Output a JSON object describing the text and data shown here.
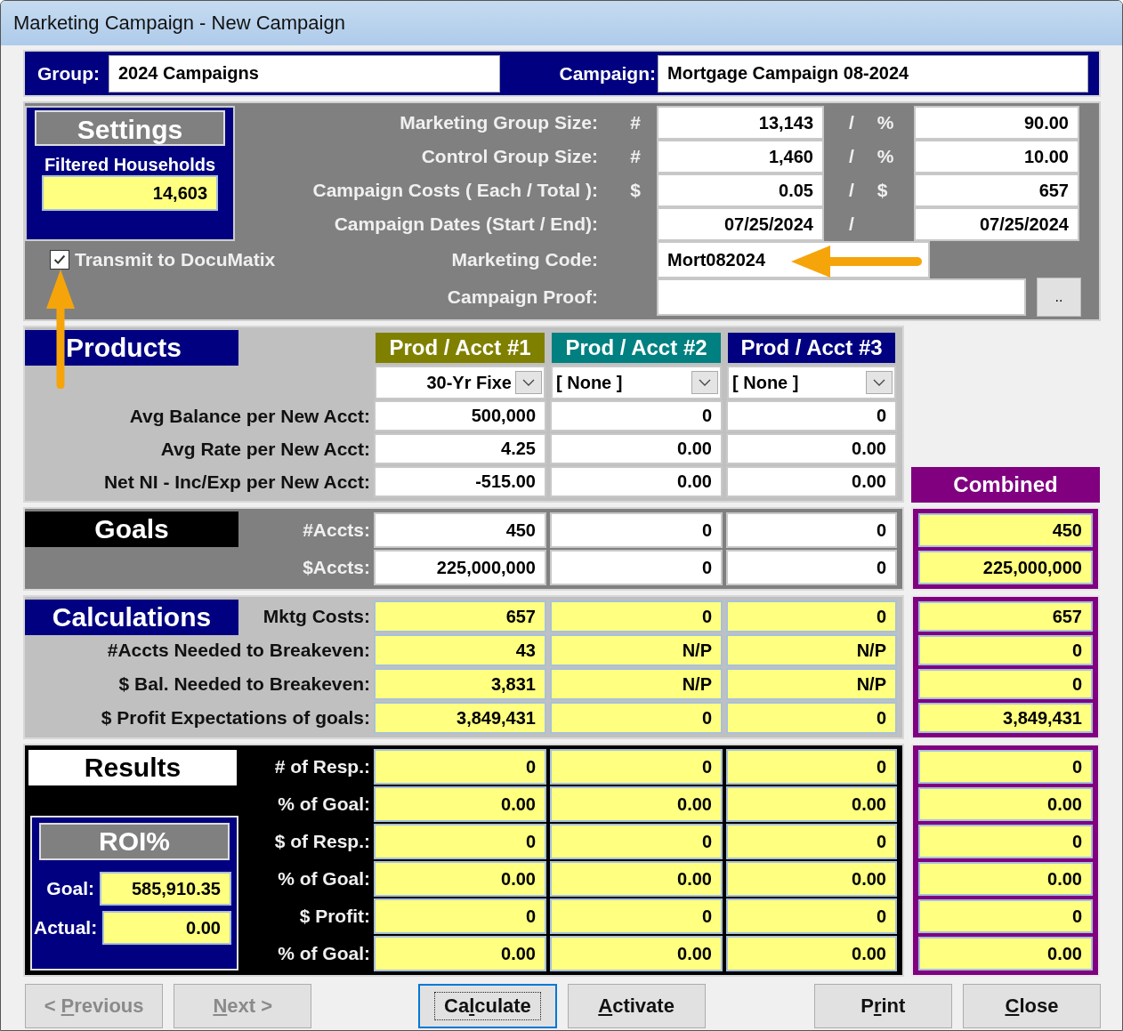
{
  "window": {
    "title": "Marketing Campaign - New Campaign"
  },
  "header": {
    "group_label": "Group:",
    "group": "2024 Campaigns",
    "campaign_label": "Campaign:",
    "campaign": "Mortgage Campaign 08-2024"
  },
  "settings": {
    "title": "Settings",
    "households_label": "Filtered Households",
    "households": "14,603",
    "transmit": {
      "label": "Transmit to DocuMatix",
      "checked": true
    },
    "rows": [
      {
        "label": "Marketing Group Size:",
        "symbol": "#",
        "value": "13,143",
        "separator": "/",
        "symbol_2": "%",
        "value_2": "90.00"
      },
      {
        "label": "Control Group Size:",
        "symbol": "#",
        "value": "1,460",
        "separator": "/",
        "symbol_2": "%",
        "value_2": "10.00"
      },
      {
        "label": "Campaign Costs ( Each / Total ):",
        "symbol": "$",
        "value": "0.05",
        "separator": "/",
        "symbol_2": "$",
        "value_2": "657"
      },
      {
        "label": "Campaign Dates  (Start / End):",
        "value": "07/25/2024",
        "separator": "/",
        "value_2": "07/25/2024"
      }
    ],
    "marketing_code": {
      "label": "Marketing Code:",
      "value": "Mort082024"
    },
    "proof": {
      "label": "Campaign Proof:",
      "button": ".."
    }
  },
  "products": {
    "title": "Products",
    "columns": [
      {
        "heading": "Prod / Acct #1",
        "color": "#808000",
        "selection": "30-Yr Fixe",
        "kind": "truncated"
      },
      {
        "heading": "Prod / Acct #2",
        "color": "#008080",
        "selection": "[ None ]",
        "kind": "plain"
      },
      {
        "heading": "Prod / Acct #3",
        "color": "#000080",
        "selection": "[ None ]",
        "kind": "plain"
      }
    ],
    "rows": [
      {
        "label": "Avg Balance per New Acct:",
        "values": [
          "500,000",
          "0",
          "0"
        ]
      },
      {
        "label": "Avg Rate per New Acct:",
        "values": [
          "4.25",
          "0.00",
          "0.00"
        ]
      },
      {
        "label": "Net NI - Inc/Exp per New Acct:",
        "values": [
          "-515.00",
          "0.00",
          "0.00"
        ]
      }
    ]
  },
  "combined": {
    "title": "Combined"
  },
  "goals": {
    "title": "Goals",
    "rows": [
      {
        "label": "#Accts:",
        "values": [
          "450",
          "0",
          "0"
        ],
        "combined": "450"
      },
      {
        "label": "$Accts:",
        "values": [
          "225,000,000",
          "0",
          "0"
        ],
        "combined": "225,000,000"
      }
    ]
  },
  "calculations": {
    "title": "Calculations",
    "rows": [
      {
        "label": "Mktg Costs:",
        "values": [
          "657",
          "0",
          "0"
        ],
        "combined": "657"
      },
      {
        "label": "#Accts Needed to Breakeven:",
        "values": [
          "43",
          "N/P",
          "N/P"
        ],
        "combined": "0"
      },
      {
        "label": "$ Bal. Needed to Breakeven:",
        "values": [
          "3,831",
          "N/P",
          "N/P"
        ],
        "combined": "0"
      },
      {
        "label": "$ Profit Expectations of goals:",
        "values": [
          "3,849,431",
          "0",
          "0"
        ],
        "combined": "3,849,431"
      }
    ]
  },
  "results": {
    "title": "Results",
    "rows": [
      {
        "label": "# of Resp.:",
        "values": [
          "0",
          "0",
          "0"
        ],
        "combined": "0"
      },
      {
        "label": "% of Goal:",
        "values": [
          "0.00",
          "0.00",
          "0.00"
        ],
        "combined": "0.00"
      },
      {
        "label": "$ of Resp.:",
        "values": [
          "0",
          "0",
          "0"
        ],
        "combined": "0"
      },
      {
        "label": "% of Goal:",
        "values": [
          "0.00",
          "0.00",
          "0.00"
        ],
        "combined": "0.00"
      },
      {
        "label": "$ Profit:",
        "values": [
          "0",
          "0",
          "0"
        ],
        "combined": "0"
      },
      {
        "label": "% of Goal:",
        "values": [
          "0.00",
          "0.00",
          "0.00"
        ],
        "combined": "0.00"
      }
    ],
    "roi": {
      "title": "ROI%",
      "goal_label": "Goal:",
      "goal": "585,910.35",
      "actual_label": "Actual:",
      "actual": "0.00"
    }
  },
  "buttons": [
    {
      "before": "< ",
      "key": "P",
      "after": "revious",
      "disabled": true,
      "focused": false
    },
    {
      "key": "N",
      "after": "ext >",
      "disabled": true,
      "focused": false
    },
    {
      "before": "Ca",
      "key": "l",
      "after": "culate",
      "disabled": false,
      "focused": true
    },
    {
      "key": "A",
      "after": "ctivate",
      "disabled": false,
      "focused": false
    },
    {
      "before": "P",
      "key": "r",
      "after": "int",
      "disabled": false,
      "focused": false
    },
    {
      "key": "C",
      "after": "lose",
      "disabled": false,
      "focused": false
    }
  ]
}
